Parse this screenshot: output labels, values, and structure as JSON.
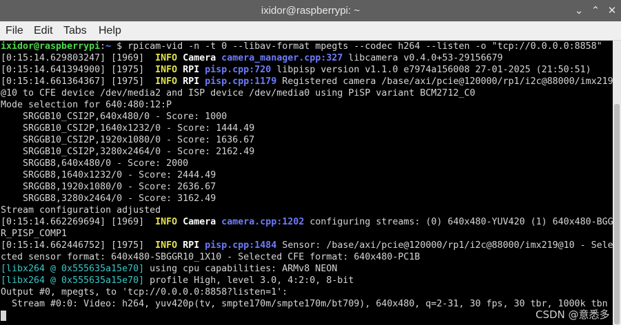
{
  "window": {
    "title": "ixidor@raspberrypi: ~",
    "buttons": {
      "minimize": "⌄",
      "maximize": "⌃",
      "close": "✕"
    }
  },
  "menu": [
    "File",
    "Edit",
    "Tabs",
    "Help"
  ],
  "terminal": {
    "prompt_user": "ixidor@raspberrypi",
    "prompt_sep": ":",
    "prompt_path": "~",
    "prompt_symbol": " $ ",
    "command": "rpicam-vid -n -t 0 --libav-format mpegts --codec h264 --listen -o \"tcp://0.0.0.0:8858\"",
    "log": [
      {
        "ts": "[0:15:14.629803247] [1969]  ",
        "level": "INFO",
        "cat": "Camera",
        "src": "camera_manager.cpp:327",
        "msg": " libcamera v0.4.0+53-29156679"
      },
      {
        "ts": "[0:15:14.641394900] [1975]  ",
        "level": "INFO",
        "cat": "RPI",
        "src": "pisp.cpp:720",
        "msg": " libpisp version v1.1.0 e7974a156008 27-01-2025 (21:50:51)"
      },
      {
        "ts": "[0:15:14.661364367] [1975]  ",
        "level": "INFO",
        "cat": "RPI",
        "src": "pisp.cpp:1179",
        "msg": " Registered camera /base/axi/pcie@120000/rp1/i2c@88000/imx219"
      }
    ],
    "plain_a": [
      "@10 to CFE device /dev/media2 and ISP device /dev/media0 using PiSP variant BCM2712_C0",
      "Mode selection for 640:480:12:P",
      "    SRGGB10_CSI2P,640x480/0 - Score: 1000",
      "    SRGGB10_CSI2P,1640x1232/0 - Score: 1444.49",
      "    SRGGB10_CSI2P,1920x1080/0 - Score: 1636.67",
      "    SRGGB10_CSI2P,3280x2464/0 - Score: 2162.49",
      "    SRGGB8,640x480/0 - Score: 2000",
      "    SRGGB8,1640x1232/0 - Score: 2444.49",
      "    SRGGB8,1920x1080/0 - Score: 2636.67",
      "    SRGGB8,3280x2464/0 - Score: 3162.49",
      "Stream configuration adjusted"
    ],
    "log2": {
      "ts": "[0:15:14.662269694] [1969]  ",
      "level": "INFO",
      "cat": "Camera",
      "src": "camera.cpp:1202",
      "msg": " configuring streams: (0) 640x480-YUV420 (1) 640x480-BGG",
      "cont": "R_PISP_COMP1"
    },
    "log3": {
      "ts": "[0:15:14.662446752] [1975]  ",
      "level": "INFO",
      "cat": "RPI",
      "src": "pisp.cpp:1484",
      "msg": " Sensor: /base/axi/pcie@120000/rp1/i2c@88000/imx219@10 - Sele",
      "cont": "cted sensor format: 640x480-SBGGR10_1X10 - Selected CFE format: 640x480-PC1B"
    },
    "lib_lines": [
      {
        "tag": "[libx264 @ 0x555635a15e70]",
        "msg": " using cpu capabilities: ARMv8 NEON"
      },
      {
        "tag": "[libx264 @ 0x555635a15e70]",
        "msg": " profile High, level 3.0, 4:2:0, 8-bit"
      }
    ],
    "tail": [
      "Output #0, mpegts, to 'tcp://0.0.0.0:8858?listen=1':",
      "  Stream #0:0: Video: h264, yuv420p(tv, smpte170m/smpte170m/bt709), 640x480, q=2-31, 30 fps, 30 tbr, 1000k tbn"
    ]
  },
  "watermark": "CSDN @意悉多"
}
